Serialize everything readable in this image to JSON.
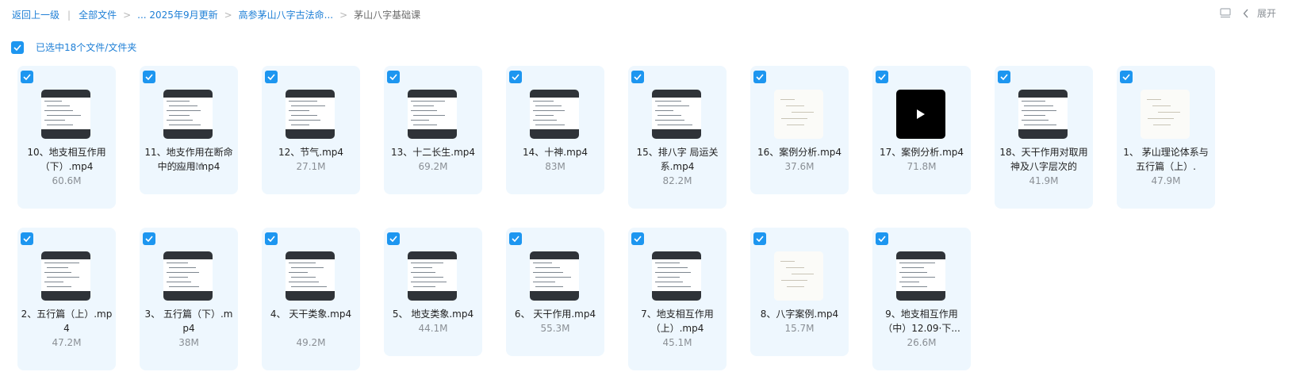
{
  "breadcrumb": {
    "back": "返回上一级",
    "items": [
      "全部文件",
      "... 2025年9月更新",
      "高参茅山八字古法命...",
      "茅山八字基础课"
    ]
  },
  "toolbar": {
    "list_view_icon": "list-view-icon",
    "collapse_label": "展开"
  },
  "selection": {
    "label": "已选中18个文件/文件夹",
    "checked": true
  },
  "files": [
    {
      "name": "10、地支相互作用（下）.mp4",
      "size": "60.6M",
      "thumb": "screen",
      "checked": true
    },
    {
      "name": "11、地支作用在断命中的应用.mp4",
      "size": "30.2M",
      "thumb": "screen",
      "checked": true
    },
    {
      "name": "12、节气.mp4",
      "size": "27.1M",
      "thumb": "screen",
      "checked": true
    },
    {
      "name": "13、十二长生.mp4",
      "size": "69.2M",
      "thumb": "screen",
      "checked": true
    },
    {
      "name": "14、十神.mp4",
      "size": "83M",
      "thumb": "screen",
      "checked": true
    },
    {
      "name": "15、排八字 局运关系.mp4",
      "size": "82.2M",
      "thumb": "screen",
      "checked": true
    },
    {
      "name": "16、案例分析.mp4",
      "size": "37.6M",
      "thumb": "pale",
      "checked": true
    },
    {
      "name": "17、案例分析.mp4",
      "size": "71.8M",
      "thumb": "video",
      "checked": true
    },
    {
      "name": "18、天干作用对取用神及八字层次的",
      "size": "41.9M",
      "thumb": "screen",
      "checked": true
    },
    {
      "name": "1、 茅山理论体系与五行篇（上）.",
      "size": "47.9M",
      "thumb": "pale",
      "checked": true
    },
    {
      "name": "2、五行篇（上）.mp4",
      "size": "47.2M",
      "thumb": "screen",
      "checked": true
    },
    {
      "name": "3、 五行篇（下）.mp4",
      "size": "38M",
      "thumb": "screen",
      "checked": true
    },
    {
      "name": "4、 天干类象.mp4",
      "size": "49.2M",
      "thumb": "screen",
      "checked": true
    },
    {
      "name": "5、 地支类象.mp4",
      "size": "44.1M",
      "thumb": "screen",
      "checked": true
    },
    {
      "name": "6、 天干作用.mp4",
      "size": "55.3M",
      "thumb": "screen",
      "checked": true
    },
    {
      "name": "7、地支相互作用（上）.mp4",
      "size": "45.1M",
      "thumb": "screen",
      "checked": true
    },
    {
      "name": "8、八字案例.mp4",
      "size": "15.7M",
      "thumb": "pale",
      "checked": true
    },
    {
      "name": "9、地支相互作用（中）12.09·下...",
      "size": "26.6M",
      "thumb": "screen",
      "checked": true
    }
  ],
  "colors": {
    "accent": "#1d96f0",
    "card_bg": "#eef7fe",
    "link": "#1e7fd6"
  }
}
